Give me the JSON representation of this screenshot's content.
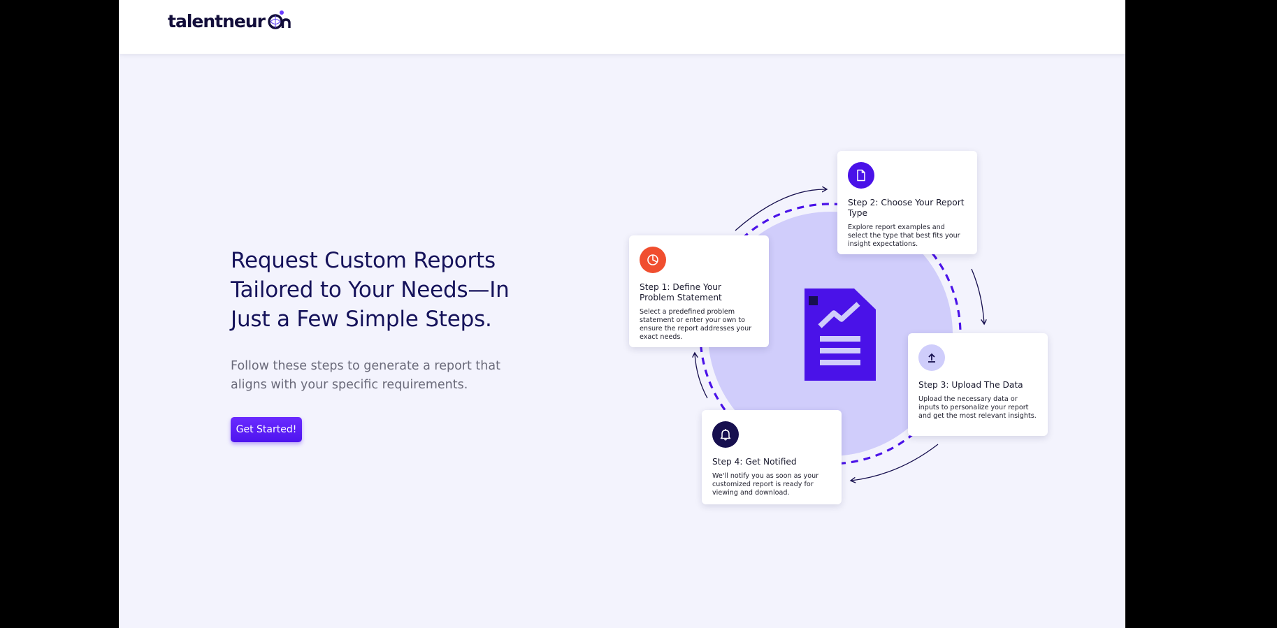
{
  "brand": {
    "name": "talentneuron",
    "name_part": "talentneur",
    "logo_icon": "neuron-globe-icon"
  },
  "hero": {
    "title": "Request Custom Reports Tailored to Your Needs—In Just a Few Simple Steps.",
    "subtitle": "Follow these steps to generate a report that aligns with your specific requirements.",
    "cta_label": "Get Started!"
  },
  "diagram": {
    "center_icon": "report-chart-document-icon",
    "steps": [
      {
        "title": "Step 1: Define Your Problem Statement",
        "description": "Select a predefined problem statement or enter your own to ensure the report addresses your exact needs.",
        "icon": "pie-chart-icon",
        "color": "#f04e2f"
      },
      {
        "title": "Step 2: Choose Your Report Type",
        "description": "Explore report examples and select the type that best fits your insight expectations.",
        "icon": "document-icon",
        "color": "#4a12e8"
      },
      {
        "title": "Step 3: Upload The Data",
        "description": "Upload the necessary data or inputs to personalize your report and get the most relevant insights.",
        "icon": "upload-icon",
        "color": "#cfcdfb"
      },
      {
        "title": "Step 4: Get Notified",
        "description": "We'll notify you as soon as your customized report is ready for viewing and download.",
        "icon": "bell-icon",
        "color": "#17104f"
      }
    ]
  },
  "colors": {
    "page_background": "#f3f3fd",
    "circle_fill": "#d0cdfb",
    "accent": "#4a12e8",
    "dark_navy": "#17104f"
  }
}
